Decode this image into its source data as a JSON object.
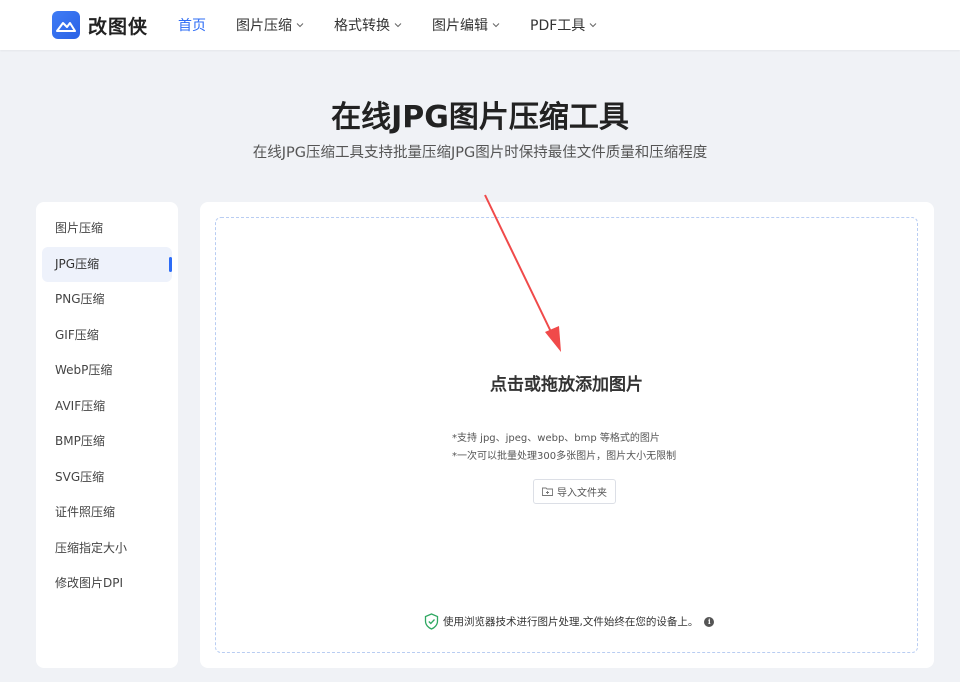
{
  "brand": {
    "name": "改图侠",
    "accent": "#2d6cf6"
  },
  "nav": {
    "items": [
      {
        "label": "首页",
        "active": true,
        "dropdown": false
      },
      {
        "label": "图片压缩",
        "active": false,
        "dropdown": true
      },
      {
        "label": "格式转换",
        "active": false,
        "dropdown": true
      },
      {
        "label": "图片编辑",
        "active": false,
        "dropdown": true
      },
      {
        "label": "PDF工具",
        "active": false,
        "dropdown": true
      }
    ]
  },
  "hero": {
    "title": "在线JPG图片压缩工具",
    "subtitle": "在线JPG压缩工具支持批量压缩JPG图片时保持最佳文件质量和压缩程度"
  },
  "sidebar": {
    "items": [
      {
        "label": "图片压缩",
        "active": false
      },
      {
        "label": "JPG压缩",
        "active": true
      },
      {
        "label": "PNG压缩",
        "active": false
      },
      {
        "label": "GIF压缩",
        "active": false
      },
      {
        "label": "WebP压缩",
        "active": false
      },
      {
        "label": "AVIF压缩",
        "active": false
      },
      {
        "label": "BMP压缩",
        "active": false
      },
      {
        "label": "SVG压缩",
        "active": false
      },
      {
        "label": "证件照压缩",
        "active": false
      },
      {
        "label": "压缩指定大小",
        "active": false
      },
      {
        "label": "修改图片DPI",
        "active": false
      }
    ]
  },
  "upload": {
    "title": "点击或拖放添加图片",
    "hint_formats": "*支持 jpg、jpeg、webp、bmp 等格式的图片",
    "hint_batch": "*一次可以批量处理300多张图片，图片大小无限制",
    "folder_button": "导入文件夹",
    "privacy_note": "使用浏览器技术进行图片处理,文件始终在您的设备上。"
  },
  "annotation": {
    "arrow_color": "#f04a4a"
  }
}
